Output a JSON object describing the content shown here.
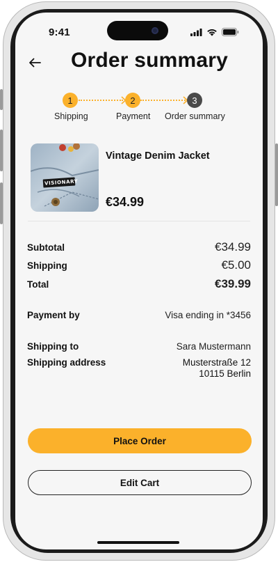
{
  "status_bar": {
    "time": "9:41"
  },
  "header": {
    "title": "Order summary"
  },
  "stepper": {
    "steps": [
      {
        "number": "1",
        "label": "Shipping"
      },
      {
        "number": "2",
        "label": "Payment"
      },
      {
        "number": "3",
        "label": "Order summary"
      }
    ]
  },
  "product": {
    "name": "Vintage Denim Jacket",
    "price": "€34.99",
    "patch_text": "VISIONARY"
  },
  "summary": {
    "subtotal_label": "Subtotal",
    "subtotal_value": "€34.99",
    "shipping_label": "Shipping",
    "shipping_value": "€5.00",
    "total_label": "Total",
    "total_value": "€39.99"
  },
  "payment": {
    "label": "Payment by",
    "value": "Visa ending in *3456"
  },
  "shipping_info": {
    "to_label": "Shipping to",
    "to_value": "Sara Mustermann",
    "address_label": "Shipping address",
    "address_line1": "Musterstraße 12",
    "address_line2": "10115 Berlin"
  },
  "actions": {
    "place_order": "Place Order",
    "edit_cart": "Edit Cart"
  },
  "colors": {
    "accent": "#fbb12b",
    "step_current": "#4a4a4a",
    "background": "#f6f6f6"
  },
  "icons": [
    "back-arrow-icon",
    "signal-icon",
    "wifi-icon",
    "battery-icon"
  ]
}
